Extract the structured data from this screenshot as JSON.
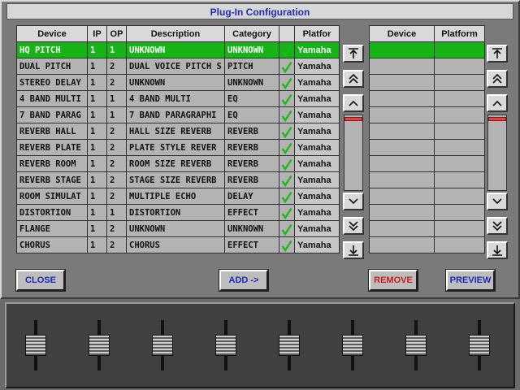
{
  "window": {
    "title": "Plug-In Configuration"
  },
  "left_table": {
    "headers": [
      "Device",
      "IP",
      "OP",
      "Description",
      "Category",
      "",
      "Platfor"
    ],
    "rows": [
      {
        "device": "HQ PITCH",
        "ip": "1",
        "op": "1",
        "description": "UNKNOWN",
        "category": "UNKNOWN",
        "enabled": true,
        "platform": "Yamaha",
        "selected": true
      },
      {
        "device": "DUAL PITCH",
        "ip": "1",
        "op": "2",
        "description": "DUAL VOICE PITCH S",
        "category": "PITCH",
        "enabled": true,
        "platform": "Yamaha",
        "selected": false
      },
      {
        "device": "STEREO DELAY",
        "ip": "1",
        "op": "2",
        "description": "UNKNOWN",
        "category": "UNKNOWN",
        "enabled": true,
        "platform": "Yamaha",
        "selected": false
      },
      {
        "device": "4 BAND MULTI",
        "ip": "1",
        "op": "1",
        "description": "4 BAND MULTI",
        "category": "EQ",
        "enabled": true,
        "platform": "Yamaha",
        "selected": false
      },
      {
        "device": "7 BAND PARAG",
        "ip": "1",
        "op": "1",
        "description": "7 BAND PARAGRAPHI",
        "category": "EQ",
        "enabled": true,
        "platform": "Yamaha",
        "selected": false
      },
      {
        "device": "REVERB HALL",
        "ip": "1",
        "op": "2",
        "description": "HALL SIZE REVERB",
        "category": "REVERB",
        "enabled": true,
        "platform": "Yamaha",
        "selected": false
      },
      {
        "device": "REVERB PLATE",
        "ip": "1",
        "op": "2",
        "description": "PLATE STYLE REVER",
        "category": "REVERB",
        "enabled": true,
        "platform": "Yamaha",
        "selected": false
      },
      {
        "device": "REVERB ROOM",
        "ip": "1",
        "op": "2",
        "description": "ROOM SIZE REVERB",
        "category": "REVERB",
        "enabled": true,
        "platform": "Yamaha",
        "selected": false
      },
      {
        "device": "REVERB STAGE",
        "ip": "1",
        "op": "2",
        "description": "STAGE SIZE REVERB",
        "category": "REVERB",
        "enabled": true,
        "platform": "Yamaha",
        "selected": false
      },
      {
        "device": "ROOM SIMULAT",
        "ip": "1",
        "op": "2",
        "description": "MULTIPLE ECHO",
        "category": "DELAY",
        "enabled": true,
        "platform": "Yamaha",
        "selected": false
      },
      {
        "device": "DISTORTION",
        "ip": "1",
        "op": "1",
        "description": "DISTORTION",
        "category": "EFFECT",
        "enabled": true,
        "platform": "Yamaha",
        "selected": false
      },
      {
        "device": "FLANGE",
        "ip": "1",
        "op": "2",
        "description": "UNKNOWN",
        "category": "UNKNOWN",
        "enabled": true,
        "platform": "Yamaha",
        "selected": false
      },
      {
        "device": "CHORUS",
        "ip": "1",
        "op": "2",
        "description": "CHORUS",
        "category": "EFFECT",
        "enabled": true,
        "platform": "Yamaha",
        "selected": false
      }
    ]
  },
  "right_table": {
    "headers": [
      "Device",
      "Platform"
    ],
    "row_count": 13,
    "selected_row": 0
  },
  "scroll_icons": [
    "scroll-top-icon",
    "page-up-icon",
    "line-up-icon",
    "line-down-icon",
    "page-down-icon",
    "scroll-bottom-icon"
  ],
  "buttons": {
    "close": "CLOSE",
    "add": "ADD ->",
    "remove": "REMOVE",
    "preview": "PREVIEW"
  },
  "colors": {
    "title_text": "#1e2bb3",
    "selected_row": "#16b416",
    "check": "#1db81d",
    "remove_text": "#c81e1e",
    "action_text": "#1e2bb3",
    "scroll_thumb": "#e04444"
  },
  "mixer": {
    "fader_count": 8
  }
}
